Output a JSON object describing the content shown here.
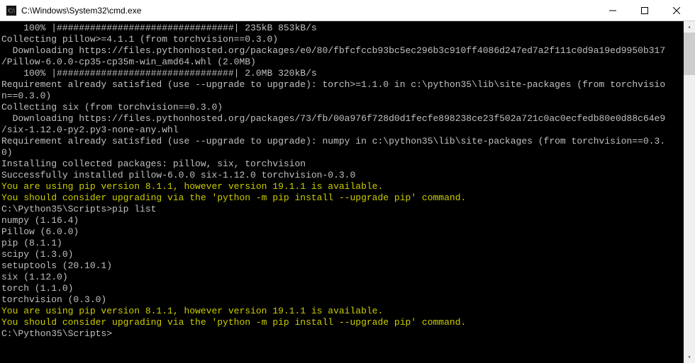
{
  "window": {
    "title": "C:\\Windows\\System32\\cmd.exe"
  },
  "terminal": {
    "lines": [
      {
        "text": "    100% |################################| 235kB 853kB/s",
        "cls": ""
      },
      {
        "text": "Collecting pillow>=4.1.1 (from torchvision==0.3.0)",
        "cls": ""
      },
      {
        "text": "  Downloading https://files.pythonhosted.org/packages/e0/80/fbfcfccb93bc5ec296b3c910ff4086d247ed7a2f111c0d9a19ed9950b317",
        "cls": ""
      },
      {
        "text": "/Pillow-6.0.0-cp35-cp35m-win_amd64.whl (2.0MB)",
        "cls": ""
      },
      {
        "text": "    100% |################################| 2.0MB 320kB/s",
        "cls": ""
      },
      {
        "text": "Requirement already satisfied (use --upgrade to upgrade): torch>=1.1.0 in c:\\python35\\lib\\site-packages (from torchvisio",
        "cls": ""
      },
      {
        "text": "n==0.3.0)",
        "cls": ""
      },
      {
        "text": "Collecting six (from torchvision==0.3.0)",
        "cls": ""
      },
      {
        "text": "  Downloading https://files.pythonhosted.org/packages/73/fb/00a976f728d0d1fecfe898238ce23f502a721c0ac0ecfedb80e0d88c64e9",
        "cls": ""
      },
      {
        "text": "/six-1.12.0-py2.py3-none-any.whl",
        "cls": ""
      },
      {
        "text": "Requirement already satisfied (use --upgrade to upgrade): numpy in c:\\python35\\lib\\site-packages (from torchvision==0.3.",
        "cls": ""
      },
      {
        "text": "0)",
        "cls": ""
      },
      {
        "text": "Installing collected packages: pillow, six, torchvision",
        "cls": ""
      },
      {
        "text": "Successfully installed pillow-6.0.0 six-1.12.0 torchvision-0.3.0",
        "cls": ""
      },
      {
        "text": "You are using pip version 8.1.1, however version 19.1.1 is available.",
        "cls": "yellow"
      },
      {
        "text": "You should consider upgrading via the 'python -m pip install --upgrade pip' command.",
        "cls": "yellow"
      },
      {
        "text": "",
        "cls": ""
      },
      {
        "text": "C:\\Python35\\Scripts>pip list",
        "cls": ""
      },
      {
        "text": "numpy (1.16.4)",
        "cls": ""
      },
      {
        "text": "Pillow (6.0.0)",
        "cls": ""
      },
      {
        "text": "pip (8.1.1)",
        "cls": ""
      },
      {
        "text": "scipy (1.3.0)",
        "cls": ""
      },
      {
        "text": "setuptools (20.10.1)",
        "cls": ""
      },
      {
        "text": "six (1.12.0)",
        "cls": ""
      },
      {
        "text": "torch (1.1.0)",
        "cls": ""
      },
      {
        "text": "torchvision (0.3.0)",
        "cls": ""
      },
      {
        "text": "You are using pip version 8.1.1, however version 19.1.1 is available.",
        "cls": "yellow"
      },
      {
        "text": "You should consider upgrading via the 'python -m pip install --upgrade pip' command.",
        "cls": "yellow"
      },
      {
        "text": "",
        "cls": ""
      },
      {
        "text": "C:\\Python35\\Scripts>",
        "cls": ""
      }
    ]
  }
}
